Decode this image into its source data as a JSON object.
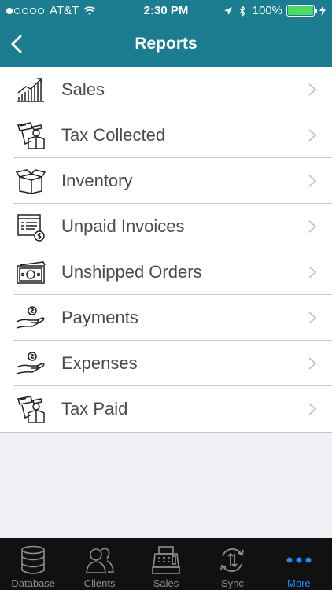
{
  "status_bar": {
    "carrier": "AT&T",
    "time": "2:30 PM",
    "battery": "100%",
    "battery_level": 1.0
  },
  "nav": {
    "title": "Reports",
    "back_icon": "chevron-left-icon"
  },
  "reports": [
    {
      "label": "Sales",
      "icon": "sales-chart-icon"
    },
    {
      "label": "Tax Collected",
      "icon": "tax-officer-icon"
    },
    {
      "label": "Inventory",
      "icon": "box-icon"
    },
    {
      "label": "Unpaid Invoices",
      "icon": "invoice-icon"
    },
    {
      "label": "Unshipped Orders",
      "icon": "cash-icon"
    },
    {
      "label": "Payments",
      "icon": "hand-coin-icon"
    },
    {
      "label": "Expenses",
      "icon": "hand-coin-icon"
    },
    {
      "label": "Tax Paid",
      "icon": "tax-officer-icon"
    }
  ],
  "tabs": [
    {
      "label": "Database",
      "icon": "database-icon"
    },
    {
      "label": "Clients",
      "icon": "clients-icon"
    },
    {
      "label": "Sales",
      "icon": "cash-register-icon"
    },
    {
      "label": "Sync",
      "icon": "sync-icon"
    },
    {
      "label": "More",
      "icon": "more-icon",
      "active": true
    }
  ],
  "colors": {
    "header": "#1b7d8f",
    "tab_active": "#1e8cff",
    "tab_inactive": "#8e8e93",
    "battery": "#4cd964"
  }
}
